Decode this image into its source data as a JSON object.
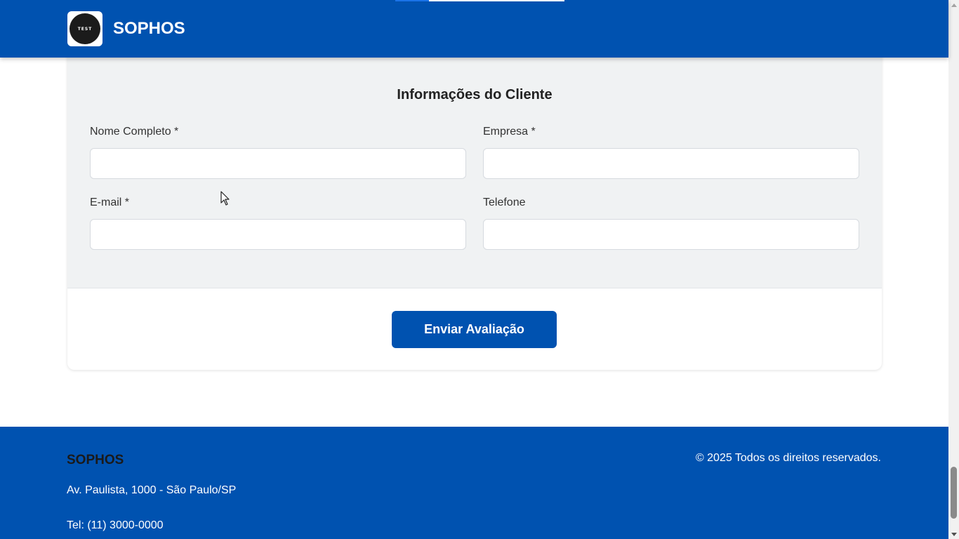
{
  "header": {
    "brand": "SOPHOS",
    "logo_text": "TEST",
    "progress_fraction": 0.2,
    "background_color": "#0052b0"
  },
  "form": {
    "section_title": "Informações do Cliente",
    "fields": {
      "full_name": {
        "label": "Nome Completo *",
        "value": ""
      },
      "company": {
        "label": "Empresa *",
        "value": ""
      },
      "email": {
        "label": "E-mail *",
        "value": ""
      },
      "phone": {
        "label": "Telefone",
        "value": ""
      }
    },
    "submit_label": "Enviar Avaliação",
    "button_color": "#0052b0"
  },
  "footer": {
    "brand": "SOPHOS",
    "address": "Av. Paulista, 1000 - São Paulo/SP",
    "phone": "Tel: (11) 3000-0000",
    "copyright": "© 2025 Todos os direitos reservados."
  },
  "icons": {
    "logo": "logo-icon",
    "cursor": "mouse-cursor-icon",
    "scroll_up": "scroll-up-arrow-icon",
    "scroll_down": "scroll-down-arrow-icon"
  },
  "scrollbar": {
    "scroll_position_fraction": 0.92
  }
}
